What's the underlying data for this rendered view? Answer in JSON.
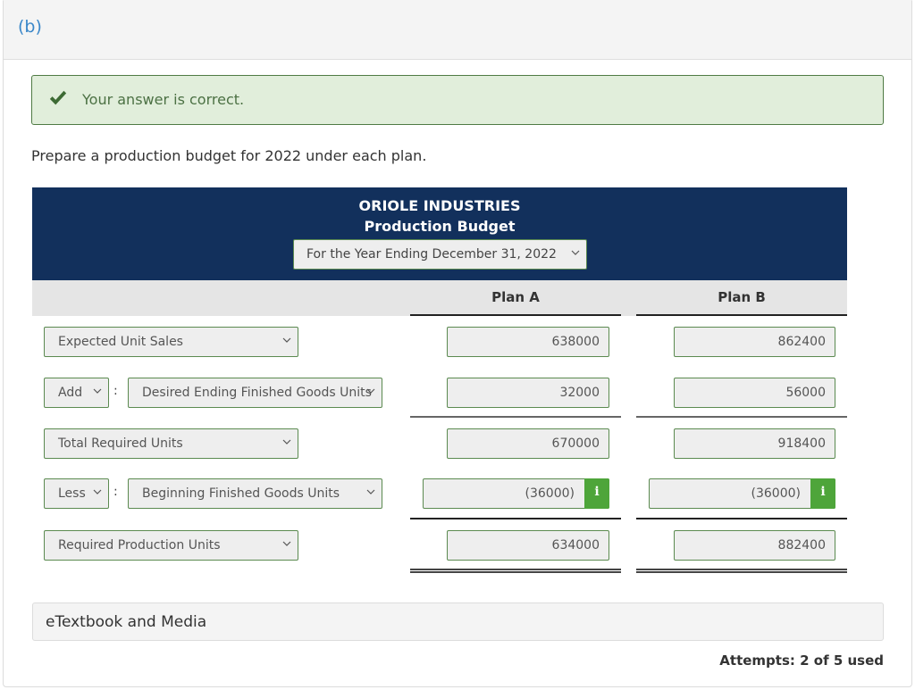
{
  "part": {
    "label": "(b)"
  },
  "feedback": {
    "icon": "check-icon",
    "message": "Your answer is correct.",
    "color": "#4c7144"
  },
  "prompt": "Prepare a production budget for 2022 under each plan.",
  "table": {
    "company": "ORIOLE INDUSTRIES",
    "title": "Production Budget",
    "period": "For the Year Ending December 31, 2022",
    "header_color": "#12305c",
    "columns": [
      "Plan A",
      "Plan B"
    ],
    "rows": [
      {
        "operator": null,
        "label": "Expected Unit Sales",
        "plan_a": "638000",
        "plan_b": "862400",
        "info": false
      },
      {
        "operator": "Add",
        "label": "Desired Ending Finished Goods Units",
        "plan_a": "32000",
        "plan_b": "56000",
        "info": false
      },
      {
        "operator": null,
        "label": "Total Required Units",
        "plan_a": "670000",
        "plan_b": "918400",
        "info": false
      },
      {
        "operator": "Less",
        "label": "Beginning Finished Goods Units",
        "plan_a": "(36000)",
        "plan_b": "(36000)",
        "info": true
      },
      {
        "operator": null,
        "label": "Required Production Units",
        "plan_a": "634000",
        "plan_b": "882400",
        "info": false
      }
    ],
    "info_icon_label": "i",
    "operator_separator": ":"
  },
  "etextbook": {
    "label": "eTextbook and Media"
  },
  "attempts": {
    "text": "Attempts: 2 of 5 used",
    "used": 2,
    "total": 5
  }
}
